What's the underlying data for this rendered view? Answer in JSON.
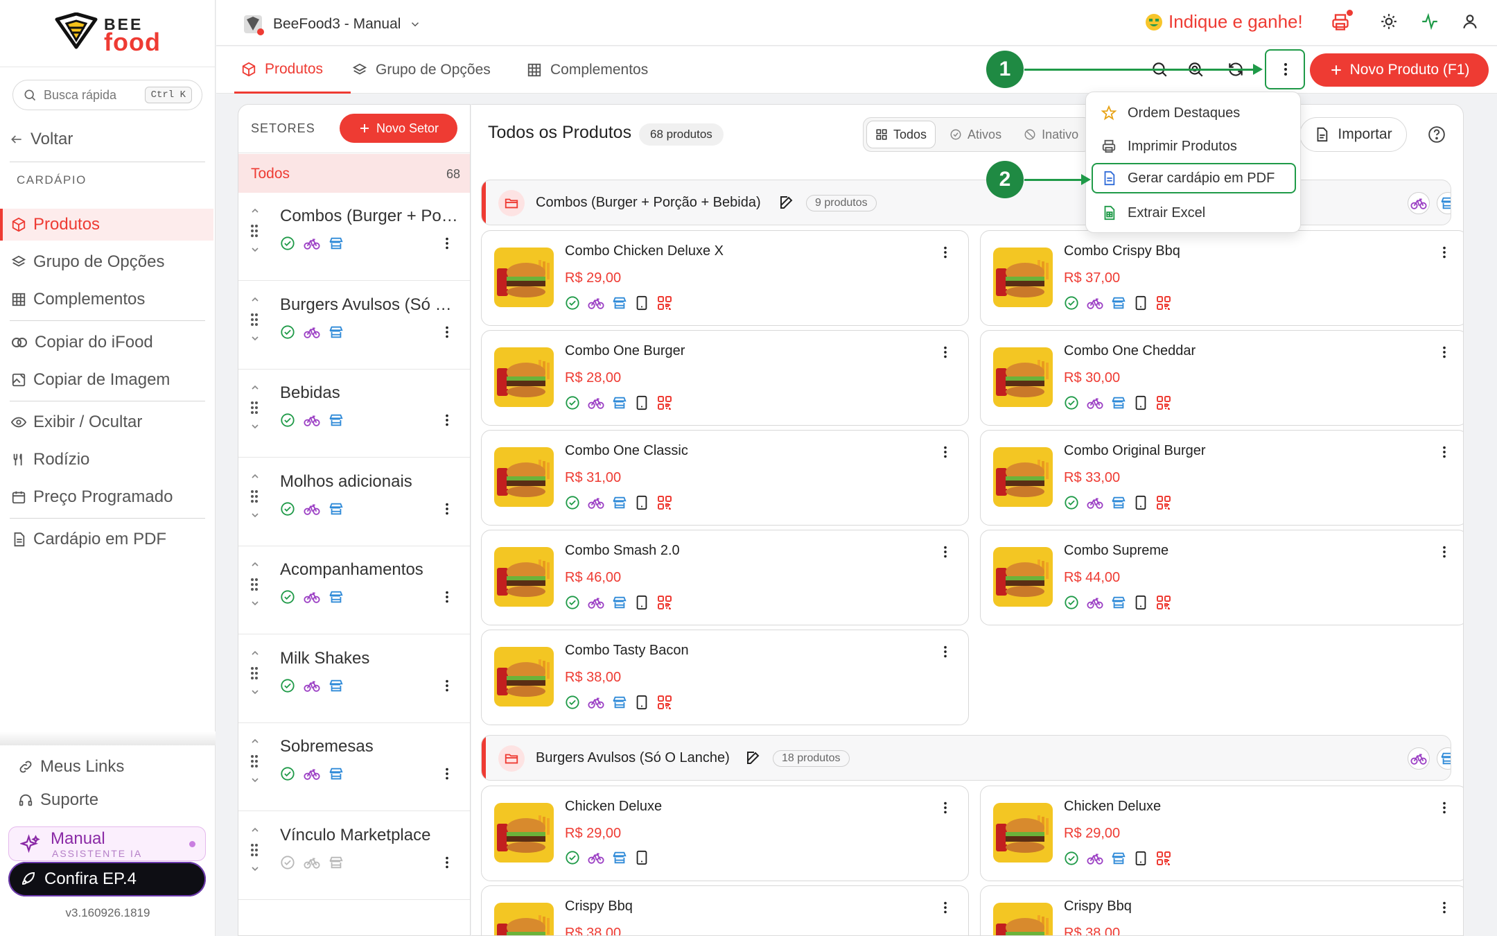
{
  "brand": {
    "bee": "BEE",
    "food": "food"
  },
  "search": {
    "placeholder": "Busca rápida",
    "shortcut": "Ctrl K"
  },
  "sidebar": {
    "back": "Voltar",
    "section": "CARDÁPIO",
    "items": [
      {
        "label": "Produtos",
        "icon": "cube-icon"
      },
      {
        "label": "Grupo de Opções",
        "icon": "layers-icon"
      },
      {
        "label": "Complementos",
        "icon": "grid-icon"
      },
      {
        "label": "Copiar do iFood",
        "icon": "ifood-icon"
      },
      {
        "label": "Copiar de Imagem",
        "icon": "image-edit-icon"
      },
      {
        "label": "Exibir / Ocultar",
        "icon": "eye-icon"
      },
      {
        "label": "Rodízio",
        "icon": "cutlery-icon"
      },
      {
        "label": "Preço Programado",
        "icon": "calendar-icon"
      },
      {
        "label": "Cardápio em PDF",
        "icon": "document-icon"
      }
    ],
    "links": [
      {
        "label": "Meus Links",
        "icon": "link-icon"
      },
      {
        "label": "Suporte",
        "icon": "headset-icon"
      }
    ],
    "assistant": {
      "title": "Manual",
      "subtitle": "ASSISTENTE IA"
    },
    "promo": "Confira EP.4",
    "version": "v3.160926.1819"
  },
  "topbar": {
    "store": "BeeFood3 - Manual",
    "referral": "Indique e ganhe!"
  },
  "tabs": [
    {
      "label": "Produtos",
      "icon": "cube-icon"
    },
    {
      "label": "Grupo de Opções",
      "icon": "layers-icon"
    },
    {
      "label": "Complementos",
      "icon": "grid-icon"
    }
  ],
  "actions": {
    "new_product": "Novo Produto (F1)"
  },
  "annotations": {
    "step1": "1",
    "step2": "2",
    "color": "#1f9a48"
  },
  "menu": [
    {
      "label": "Ordem Destaques",
      "icon": "star-icon",
      "color": "#e8a317"
    },
    {
      "label": "Imprimir Produtos",
      "icon": "printer-icon",
      "color": "#555555"
    },
    {
      "label": "Gerar cardápio em PDF",
      "icon": "pdf-icon",
      "color": "#2f6bd8"
    },
    {
      "label": "Extrair Excel",
      "icon": "excel-icon",
      "color": "#1f9a48"
    }
  ],
  "sectors": {
    "title": "SETORES",
    "new_label": "Novo Setor",
    "all_label": "Todos",
    "all_count": "68",
    "items": [
      {
        "name": "Combos (Burger + Porção + Bebida)",
        "active": true
      },
      {
        "name": "Burgers Avulsos (Só O Lanche)",
        "active": true
      },
      {
        "name": "Bebidas",
        "active": true
      },
      {
        "name": "Molhos adicionais",
        "active": true
      },
      {
        "name": "Acompanhamentos",
        "active": true
      },
      {
        "name": "Milk Shakes",
        "active": true
      },
      {
        "name": "Sobremesas",
        "active": true
      },
      {
        "name": "Vínculo Marketplace",
        "active": false
      }
    ]
  },
  "products": {
    "title": "Todos os Produtos",
    "count": "68 produtos",
    "filters": [
      "Todos",
      "Ativos",
      "Inativo"
    ],
    "import_label": "Importar",
    "categories": [
      {
        "name": "Combos (Burger + Porção + Bebida)",
        "count": "9 produtos",
        "items": [
          {
            "name": "Combo Chicken Deluxe X",
            "price": "R$ 29,00"
          },
          {
            "name": "Combo Crispy Bbq",
            "price": "R$ 37,00"
          },
          {
            "name": "Combo One Burger",
            "price": "R$ 28,00"
          },
          {
            "name": "Combo One Cheddar",
            "price": "R$ 30,00"
          },
          {
            "name": "Combo One Classic",
            "price": "R$ 31,00"
          },
          {
            "name": "Combo Original Burger",
            "price": "R$ 33,00"
          },
          {
            "name": "Combo Smash 2.0",
            "price": "R$ 46,00"
          },
          {
            "name": "Combo Supreme",
            "price": "R$ 44,00"
          },
          {
            "name": "Combo Tasty Bacon",
            "price": "R$ 38,00"
          }
        ]
      },
      {
        "name": "Burgers Avulsos (Só O Lanche)",
        "count": "18 produtos",
        "items": [
          {
            "name": "Chicken Deluxe",
            "price": "R$ 29,00"
          },
          {
            "name": "Chicken Deluxe",
            "price": "R$ 29,00"
          },
          {
            "name": "Crispy Bbq",
            "price": "R$ 38,00"
          },
          {
            "name": "Crispy Bbq",
            "price": "R$ 38,00"
          }
        ]
      }
    ]
  },
  "colors": {
    "accent": "#ee3b33",
    "success": "#1f9a48",
    "delivery": "#9b3fc4",
    "store": "#2f8ad8"
  }
}
